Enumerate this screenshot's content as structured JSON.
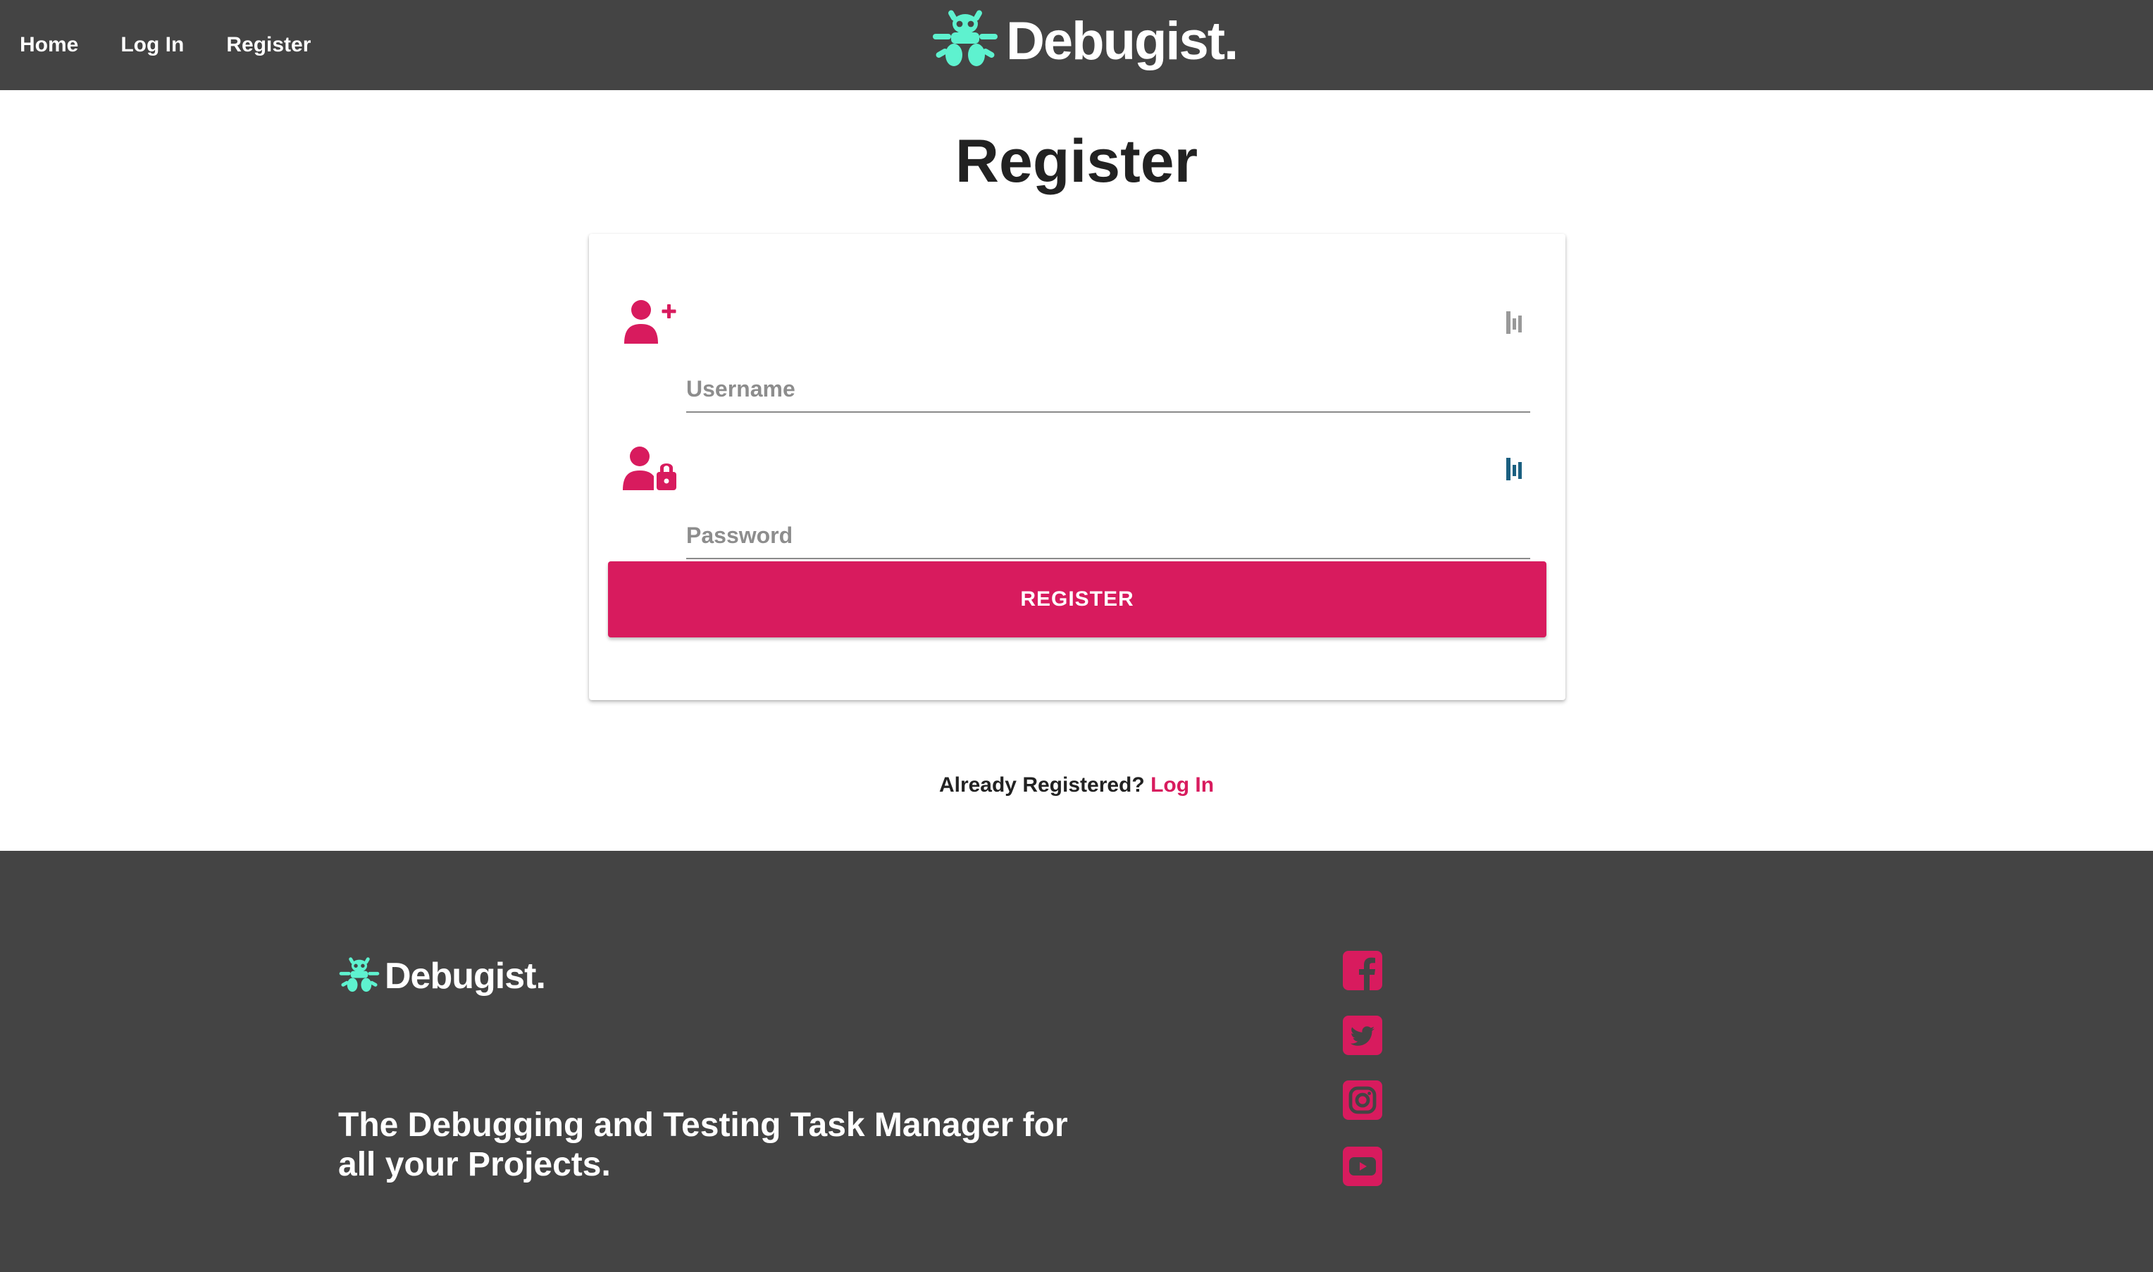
{
  "nav": {
    "links": [
      "Home",
      "Log In",
      "Register"
    ],
    "brand": "Debugist."
  },
  "main": {
    "title": "Register",
    "username_placeholder": "Username",
    "password_placeholder": "Password",
    "register_button": "REGISTER",
    "already_text": "Already Registered?",
    "login_link": "Log In"
  },
  "footer": {
    "brand": "Debugist.",
    "tagline": "The Debugging and Testing Task Manager for all your Projects.",
    "social_icons": [
      "facebook-icon",
      "twitter-icon",
      "instagram-icon",
      "youtube-icon"
    ]
  },
  "colors": {
    "nav_bg": "#444444",
    "accent": "#d81b5e",
    "logo_teal": "#5ef2cf",
    "text_dark": "#222222"
  }
}
